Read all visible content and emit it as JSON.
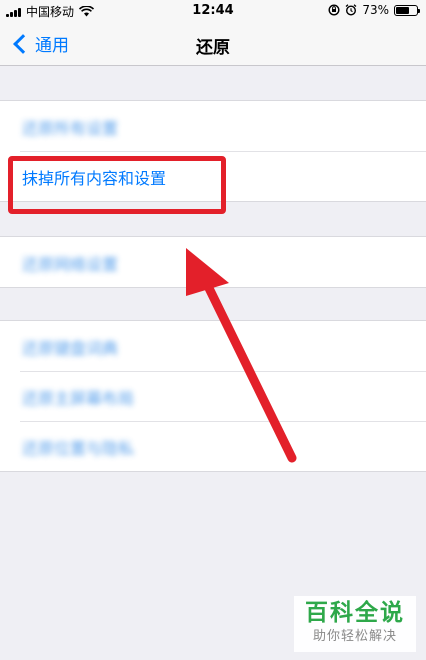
{
  "status_bar": {
    "carrier": "中国移动",
    "time": "12:44",
    "battery_percent": "73%",
    "battery_level": 0.73,
    "icons": [
      "signal-icon",
      "wifi-icon",
      "rotation-lock-icon",
      "alarm-icon",
      "battery-icon"
    ]
  },
  "nav": {
    "back_label": "通用",
    "title": "还原"
  },
  "settings": {
    "group1": [
      {
        "label": "还原所有设置"
      },
      {
        "label": "抹掉所有内容和设置"
      }
    ],
    "group2": [
      {
        "label": "还原网络设置"
      }
    ],
    "group3": [
      {
        "label": "还原键盘词典"
      },
      {
        "label": "还原主屏幕布局"
      },
      {
        "label": "还原位置与隐私"
      }
    ]
  },
  "annotation": {
    "highlight_color": "#e3202a",
    "arrow_color": "#e3202a"
  },
  "watermark": {
    "logo": "百科全说",
    "slogan": "助你轻松解决",
    "color": "#2ea84a"
  },
  "colors": {
    "ios_blue": "#007aff",
    "background": "#efeff4"
  }
}
